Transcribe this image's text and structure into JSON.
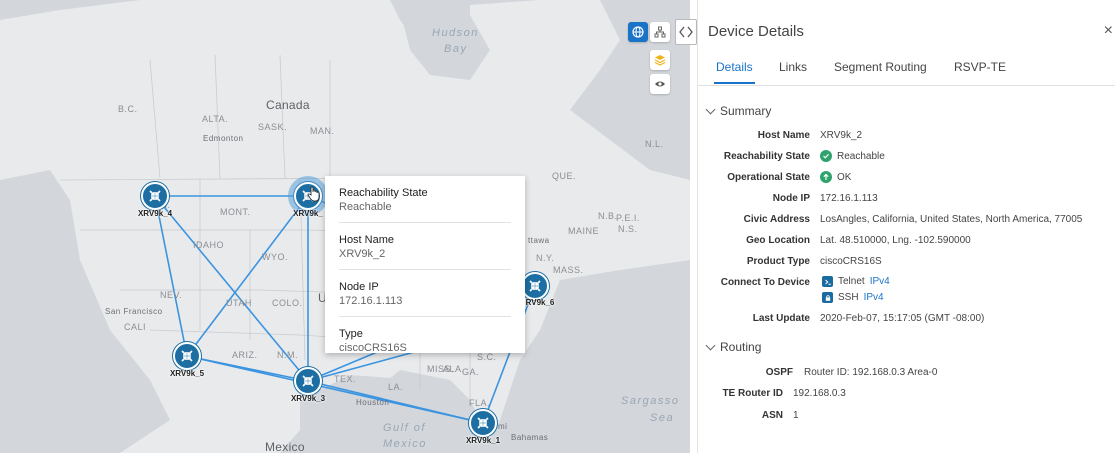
{
  "map": {
    "labels": {
      "hudson": "Hudson",
      "bay": "Bay",
      "canada": "Canada",
      "bc": "B.C.",
      "alta": "ALTA.",
      "sask": "SASK.",
      "man": "MAN.",
      "edmonton": "Edmonton",
      "nl": "N.L.",
      "que": "QUE.",
      "nb": "N.B.",
      "pei": "P.E.I.",
      "ns": "N.S.",
      "maine": "MAINE",
      "ottawa": "ttawa",
      "ny": "N.Y.",
      "mass": "MASS.",
      "mont": "MONT.",
      "wash": "SH.",
      "idaho": "IDAHO",
      "wyo": "WYO.",
      "nev": "NEV.",
      "utah": "UTAH",
      "colo": "COLO.",
      "us": "U",
      "sf": "San Francisco",
      "calif": "CALI",
      "ariz": "ARIZ.",
      "nm": "N.M.",
      "tex": "TEX.",
      "la": "LA.",
      "miss": "MISS.",
      "ala": "ALA.",
      "ga": "GA.",
      "sc": "S.C.",
      "fla": "FLA.",
      "houston": "Houston",
      "sargasso": "Sargasso",
      "sea": "Sea",
      "gulf": "Gulf of",
      "mexico_water": "Mexico",
      "mexico": "Mexico",
      "bahamas": "Bahamas",
      "miami": "mi"
    },
    "nodes": [
      {
        "id": "n4",
        "label": "XRV9k_4"
      },
      {
        "id": "n2",
        "label": "XRV9k_"
      },
      {
        "id": "n6",
        "label": "RV9k_6"
      },
      {
        "id": "n5",
        "label": "XRV9k_5"
      },
      {
        "id": "n3",
        "label": "XRV9k_3"
      },
      {
        "id": "n1",
        "label": "XRV9k_1"
      }
    ],
    "controls": [
      "globe-icon",
      "topology-icon",
      "layers-icon",
      "eye-icon"
    ]
  },
  "tooltip": {
    "reach_label": "Reachability State",
    "reach_value": "Reachable",
    "host_label": "Host Name",
    "host_value": "XRV9k_2",
    "ip_label": "Node IP",
    "ip_value": "172.16.1.113",
    "type_label": "Type",
    "type_value": "ciscoCRS16S"
  },
  "panel": {
    "title": "Device Details",
    "close": "×",
    "tabs": [
      "Details",
      "Links",
      "Segment Routing",
      "RSVP-TE"
    ],
    "summary": {
      "title": "Summary",
      "host_label": "Host Name",
      "host_value": "XRV9k_2",
      "reach_label": "Reachability State",
      "reach_value": "Reachable",
      "oper_label": "Operational State",
      "oper_value": "OK",
      "ip_label": "Node IP",
      "ip_value": "172.16.1.113",
      "civic_label": "Civic Address",
      "civic_value": "LosAngles, California, United States, North America, 77005",
      "geo_label": "Geo Location",
      "geo_value": "Lat. 48.510000, Lng. -102.590000",
      "ptype_label": "Product Type",
      "ptype_value": "ciscoCRS16S",
      "connect_label": "Connect To Device",
      "telnet": "Telnet",
      "telnet_link": "IPv4",
      "ssh": "SSH",
      "ssh_link": "IPv4",
      "update_label": "Last Update",
      "update_value": "2020-Feb-07, 15:17:05 (GMT -08:00)"
    },
    "routing": {
      "title": "Routing",
      "ospf_label": "OSPF",
      "ospf_value": "Router ID: 192.168.0.3 Area-0",
      "te_label": "TE Router ID",
      "te_value": "192.168.0.3",
      "asn_label": "ASN",
      "asn_value": "1"
    }
  },
  "colors": {
    "accent": "#1a73c7",
    "node": "#1d6fa3",
    "link": "#3b94e0",
    "ok": "#2fa36b"
  }
}
